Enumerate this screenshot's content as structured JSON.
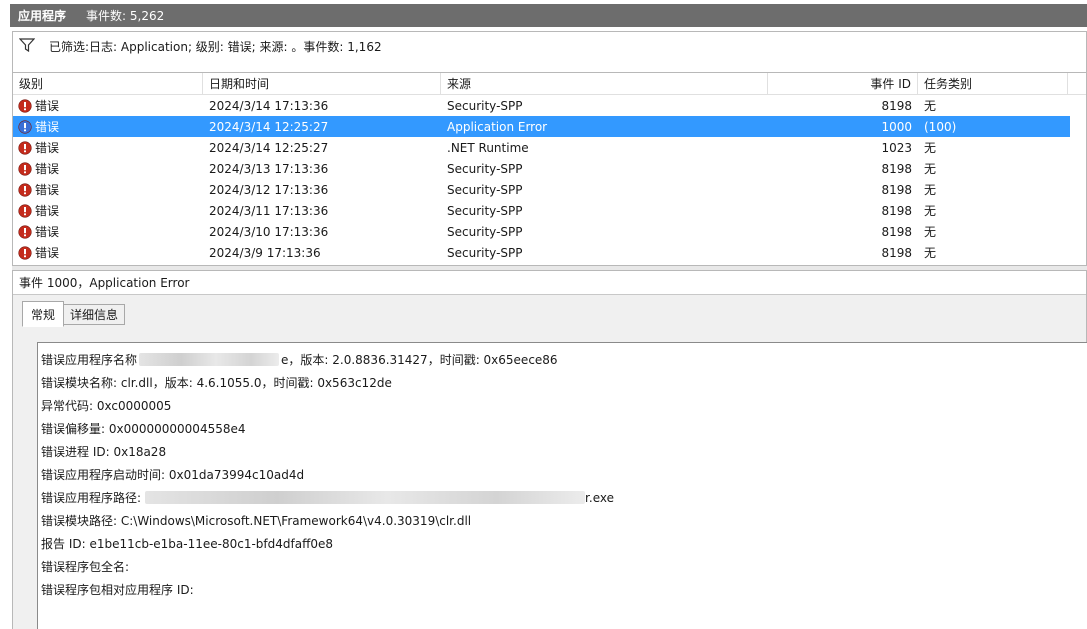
{
  "titlebar": {
    "app_title": "应用程序",
    "event_count": "事件数: 5,262"
  },
  "filter": {
    "text": "已筛选:日志: Application; 级别: 错误; 来源: 。事件数: 1,162"
  },
  "columns": {
    "level": "级别",
    "date": "日期和时间",
    "source": "来源",
    "event_id": "事件 ID",
    "task": "任务类别"
  },
  "rows": [
    {
      "level": "错误",
      "date": "2024/3/14 17:13:36",
      "source": "Security-SPP",
      "id": "8198",
      "task": "无"
    },
    {
      "level": "错误",
      "date": "2024/3/14 12:25:27",
      "source": "Application Error",
      "id": "1000",
      "task": "(100)"
    },
    {
      "level": "错误",
      "date": "2024/3/14 12:25:27",
      "source": ".NET Runtime",
      "id": "1023",
      "task": "无"
    },
    {
      "level": "错误",
      "date": "2024/3/13 17:13:36",
      "source": "Security-SPP",
      "id": "8198",
      "task": "无"
    },
    {
      "level": "错误",
      "date": "2024/3/12 17:13:36",
      "source": "Security-SPP",
      "id": "8198",
      "task": "无"
    },
    {
      "level": "错误",
      "date": "2024/3/11 17:13:36",
      "source": "Security-SPP",
      "id": "8198",
      "task": "无"
    },
    {
      "level": "错误",
      "date": "2024/3/10 17:13:36",
      "source": "Security-SPP",
      "id": "8198",
      "task": "无"
    },
    {
      "level": "错误",
      "date": "2024/3/9 17:13:36",
      "source": "Security-SPP",
      "id": "8198",
      "task": "无"
    }
  ],
  "selected_row": 1,
  "detail": {
    "title": "事件 1000，Application Error",
    "tabs": [
      "常规",
      "详细信息"
    ],
    "lines": {
      "l1a": "错误应用程序名称",
      "l1b": "，版本: 2.0.8836.31427，时间戳: 0x65eece86",
      "l1c": "e",
      "l2": "错误模块名称: clr.dll，版本: 4.6.1055.0，时间戳: 0x563c12de",
      "l3": "异常代码: 0xc0000005",
      "l4": "错误偏移量: 0x00000000004558e4",
      "l5": "错误进程 ID: 0x18a28",
      "l6": "错误应用程序启动时间: 0x01da73994c10ad4d",
      "l7a": "错误应用程序路径:",
      "l7b": "r.exe",
      "l8": "错误模块路径: C:\\Windows\\Microsoft.NET\\Framework64\\v4.0.30319\\clr.dll",
      "l9": "报告 ID: e1be11cb-e1ba-11ee-80c1-bfd4dfaff0e8",
      "l10": "错误程序包全名:",
      "l11": "错误程序包相对应用程序 ID:"
    }
  },
  "colors": {
    "selection": "#3399ff",
    "titlebar": "#6d6d6d",
    "error_red": "#c42b1c",
    "info_blue": "#3a6fd6"
  },
  "icons": {
    "error": "error-icon",
    "filter": "filter-icon"
  }
}
